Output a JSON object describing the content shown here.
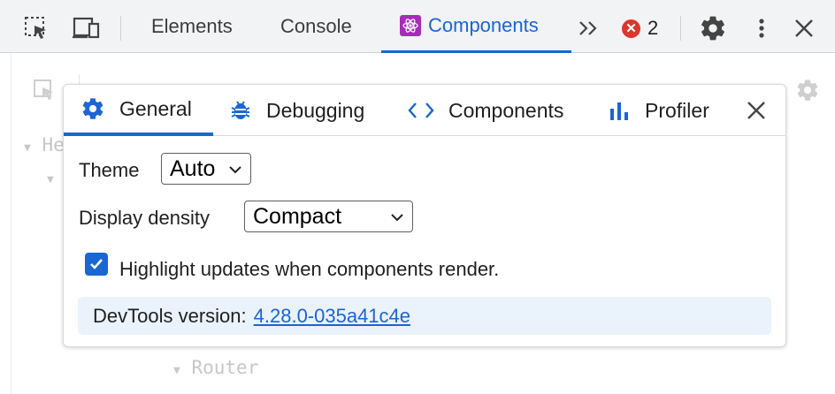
{
  "toolbar": {
    "tabs": [
      {
        "label": "Elements"
      },
      {
        "label": "Console"
      },
      {
        "label": "Components"
      }
    ],
    "error_count": "2",
    "more_symbol": "»"
  },
  "background": {
    "tree_items": [
      "Router"
    ],
    "partial_text": "He"
  },
  "settings": {
    "tabs": [
      {
        "label": "General",
        "icon": "gear-icon"
      },
      {
        "label": "Debugging",
        "icon": "bug-icon"
      },
      {
        "label": "Components",
        "icon": "code-icon"
      },
      {
        "label": "Profiler",
        "icon": "bar-chart-icon"
      }
    ],
    "theme": {
      "label": "Theme",
      "value": "Auto"
    },
    "density": {
      "label": "Display density",
      "value": "Compact"
    },
    "highlight": {
      "label": "Highlight updates when components render.",
      "checked": true
    },
    "version": {
      "label": "DevTools version:",
      "value": "4.28.0-035a41c4e"
    }
  },
  "colors": {
    "accent": "#1a66d2",
    "error": "#dc362e",
    "react_badge": "#a62bb8",
    "version_bg": "#eaf2fc"
  }
}
